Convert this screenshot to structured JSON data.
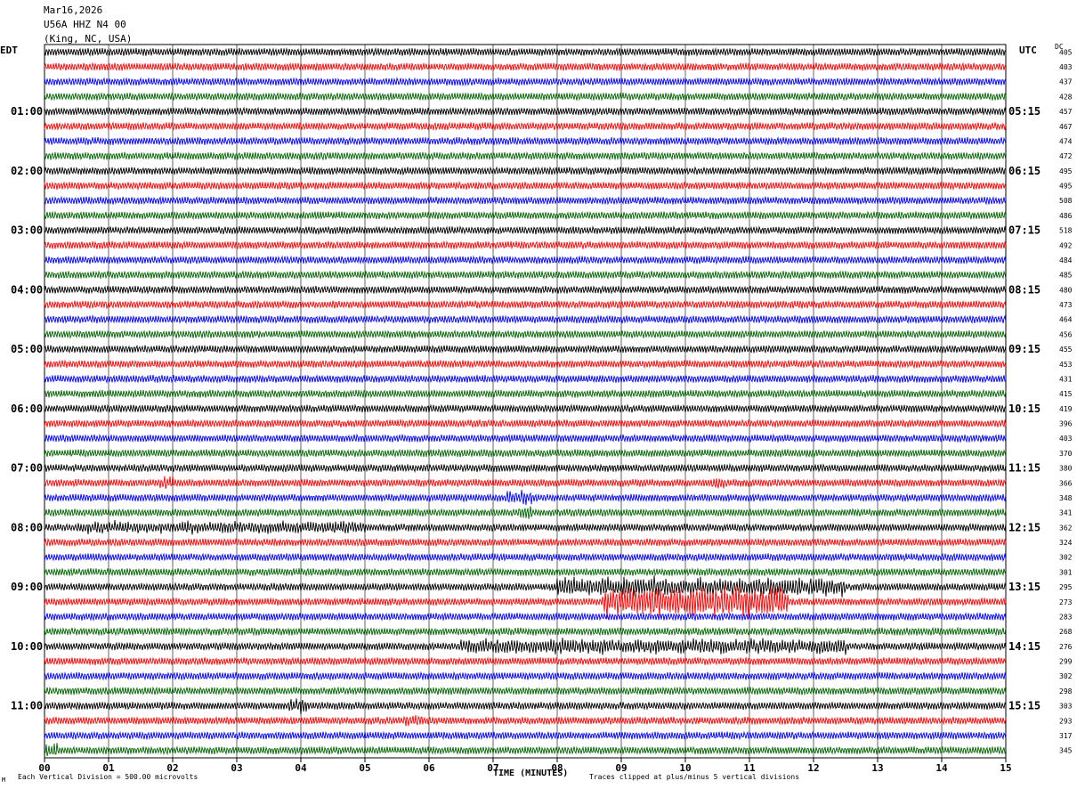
{
  "header": {
    "date": "Mar16,2026",
    "station": "U56A HHZ N4 00",
    "location": "(King, NC, USA)"
  },
  "left_tz": "EDT",
  "right_tz": "UTC",
  "dc_label": "DC",
  "footer": {
    "scale_note": "Each Vertical Division =  500.00 microvolts",
    "x_title": "TIME (MINUTES)",
    "clip_note": "Traces clipped at plus/minus 5 vertical divisions",
    "corner_mark": "M"
  },
  "chart_data": {
    "type": "line",
    "title": "U56A HHZ N4 00",
    "xlabel": "TIME (MINUTES)",
    "ylabel": "",
    "xlim": [
      0,
      15
    ],
    "x_ticks": [
      "00",
      "01",
      "02",
      "03",
      "04",
      "05",
      "06",
      "07",
      "08",
      "09",
      "10",
      "11",
      "12",
      "13",
      "14",
      "15"
    ],
    "rows_per_hour": 4,
    "trace_colors": [
      "#000000",
      "#ff0000",
      "#0000ff",
      "#006400"
    ],
    "left_hour_labels": [
      "01:00",
      "02:00",
      "03:00",
      "04:00",
      "05:00",
      "06:00",
      "07:00",
      "08:00",
      "09:00",
      "10:00",
      "11:00"
    ],
    "right_hour_labels": [
      "05:15",
      "06:15",
      "07:15",
      "08:15",
      "09:15",
      "10:15",
      "11:15",
      "12:15",
      "13:15",
      "14:15",
      "15:15"
    ],
    "dc_offsets": [
      "405",
      "403",
      "437",
      "428",
      "457",
      "467",
      "474",
      "472",
      "495",
      "495",
      "508",
      "486",
      "518",
      "492",
      "484",
      "485",
      "480",
      "473",
      "464",
      "456",
      "455",
      "453",
      "431",
      "415",
      "419",
      "396",
      "403",
      "370",
      "380",
      "366",
      "348",
      "341",
      "362",
      "324",
      "302",
      "301",
      "295",
      "273",
      "283",
      "268",
      "276",
      "299",
      "302",
      "298",
      "303",
      "293",
      "317",
      "345"
    ],
    "events": [
      {
        "row": 36,
        "start_min": 8.0,
        "end_min": 12.5,
        "amplitude": 2.0
      },
      {
        "row": 37,
        "start_min": 8.7,
        "end_min": 11.6,
        "amplitude": 3.2
      },
      {
        "row": 40,
        "start_min": 6.5,
        "end_min": 12.5,
        "amplitude": 1.6
      },
      {
        "row": 30,
        "start_min": 7.2,
        "end_min": 7.6,
        "amplitude": 1.6
      },
      {
        "row": 31,
        "start_min": 7.4,
        "end_min": 7.6,
        "amplitude": 1.5
      },
      {
        "row": 44,
        "start_min": 3.8,
        "end_min": 4.1,
        "amplitude": 1.6
      },
      {
        "row": 45,
        "start_min": 5.6,
        "end_min": 5.9,
        "amplitude": 1.4
      },
      {
        "row": 47,
        "start_min": 0.0,
        "end_min": 0.2,
        "amplitude": 1.6
      },
      {
        "row": 29,
        "start_min": 1.8,
        "end_min": 2.0,
        "amplitude": 1.5
      },
      {
        "row": 29,
        "start_min": 10.4,
        "end_min": 10.6,
        "amplitude": 1.5
      },
      {
        "row": 32,
        "start_min": 0.5,
        "end_min": 5.0,
        "amplitude": 1.3
      }
    ]
  }
}
